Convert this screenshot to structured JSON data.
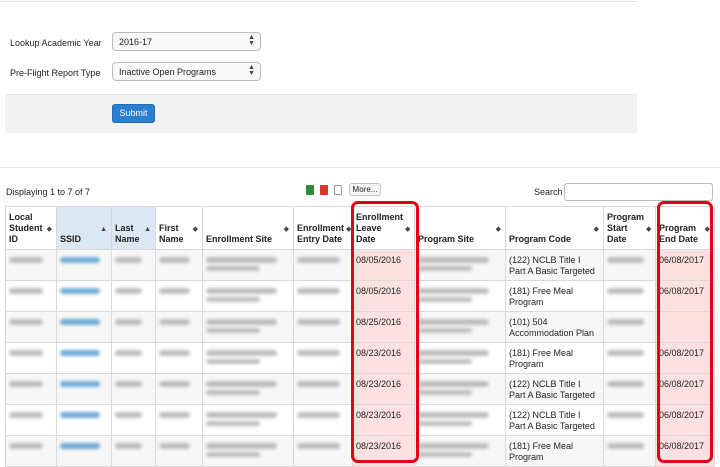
{
  "form": {
    "academic_year_label": "Lookup Academic Year",
    "academic_year_value": "2016-17",
    "report_type_label": "Pre-Flight Report Type",
    "report_type_value": "Inactive Open Programs",
    "submit_label": "Submit"
  },
  "toolbar": {
    "display_count": "Displaying 1 to 7 of 7",
    "more_label": "More...",
    "search_label": "Search",
    "export_icons": [
      {
        "name": "excel-export-icon",
        "color": "#2e8b3a"
      },
      {
        "name": "pdf-export-icon",
        "color": "#d9342b"
      },
      {
        "name": "text-export-icon",
        "color": "#9a9a9a"
      }
    ]
  },
  "table": {
    "headers": {
      "local_id": "Local Student ID",
      "ssid": "SSID",
      "last_name": "Last Name",
      "first_name": "First Name",
      "enrollment_site": "Enrollment Site",
      "enrollment_entry": "Enrollment Entry Date",
      "enrollment_leave": "Enrollment Leave Date",
      "program_site": "Program Site",
      "program_code": "Program Code",
      "program_start": "Program Start Date",
      "program_end": "Program End Date"
    },
    "rows": [
      {
        "leave_date": "08/05/2016",
        "program_code": "(122) NCLB Title I Part A Basic Targeted",
        "end_date": "06/08/2017"
      },
      {
        "leave_date": "08/05/2016",
        "program_code": "(181) Free Meal Program",
        "end_date": "06/08/2017"
      },
      {
        "leave_date": "08/25/2016",
        "program_code": "(101) 504 Accommodation Plan",
        "end_date": ""
      },
      {
        "leave_date": "08/23/2016",
        "program_code": "(181) Free Meal Program",
        "end_date": "06/08/2017"
      },
      {
        "leave_date": "08/23/2016",
        "program_code": "(122) NCLB Title I Part A Basic Targeted",
        "end_date": "06/08/2017"
      },
      {
        "leave_date": "08/23/2016",
        "program_code": "(122) NCLB Title I Part A Basic Targeted",
        "end_date": "06/08/2017"
      },
      {
        "leave_date": "08/23/2016",
        "program_code": "(181) Free Meal Program",
        "end_date": "06/08/2017"
      }
    ]
  },
  "colors": {
    "highlight_box": "#e0001b",
    "highlight_fill": "#fde0e0",
    "submit_button": "#2a7fd1",
    "sorted_column": "#dbe8f3"
  }
}
